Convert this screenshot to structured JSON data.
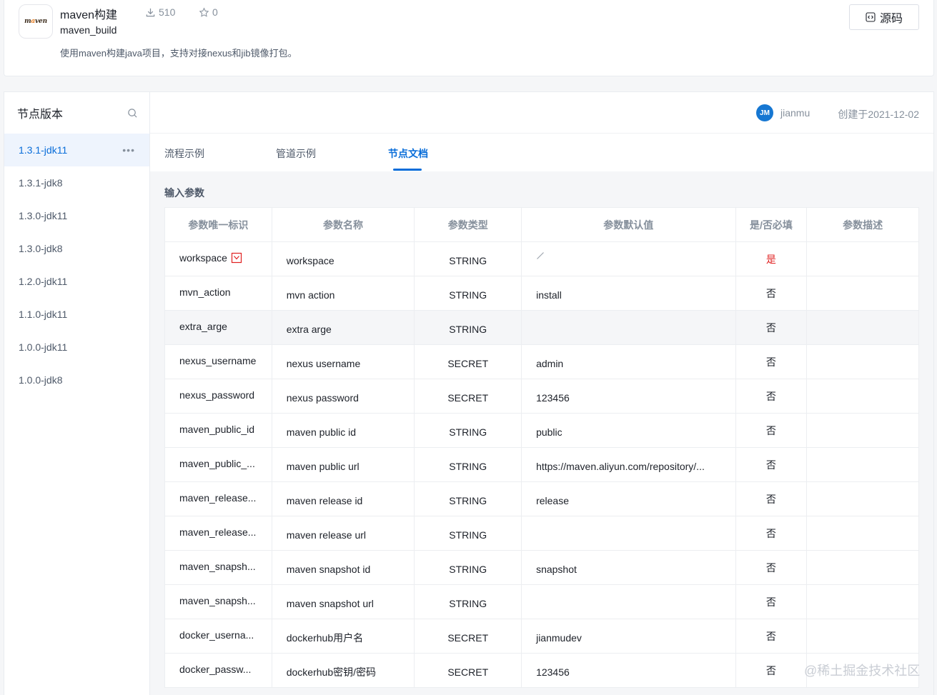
{
  "header": {
    "title": "maven构建",
    "name": "maven_build",
    "description": "使用maven构建java项目，支持对接nexus和jib镜像打包。",
    "downloads": "510",
    "stars": "0",
    "source_button": "源码",
    "logo_text_1": "m",
    "logo_text_a": "a",
    "logo_text_2": "ven"
  },
  "sidebar": {
    "title": "节点版本",
    "versions": [
      "1.3.1-jdk11",
      "1.3.1-jdk8",
      "1.3.0-jdk11",
      "1.3.0-jdk8",
      "1.2.0-jdk11",
      "1.1.0-jdk11",
      "1.0.0-jdk11",
      "1.0.0-jdk8"
    ],
    "active_index": 0,
    "more_glyph": "•••"
  },
  "meta": {
    "avatar_text": "JM",
    "author": "jianmu",
    "created": "创建于2021-12-02"
  },
  "tabs": [
    "流程示例",
    "管道示例",
    "节点文档"
  ],
  "section_title": "输入参数",
  "table": {
    "headers": [
      "参数唯一标识",
      "参数名称",
      "参数类型",
      "参数默认值",
      "是/否必填",
      "参数描述"
    ],
    "rows": [
      {
        "key": "workspace",
        "name": "workspace",
        "type": "STRING",
        "default": "",
        "required": "是"
      },
      {
        "key": "mvn_action",
        "name": "mvn action",
        "type": "STRING",
        "default": "install",
        "required": "否"
      },
      {
        "key": "extra_arge",
        "name": "extra arge",
        "type": "STRING",
        "default": "",
        "required": "否"
      },
      {
        "key": "nexus_username",
        "name": "nexus username",
        "type": "SECRET",
        "default": "admin",
        "required": "否"
      },
      {
        "key": "nexus_password",
        "name": "nexus password",
        "type": "SECRET",
        "default": "123456",
        "required": "否"
      },
      {
        "key": "maven_public_id",
        "name": "maven public id",
        "type": "STRING",
        "default": "public",
        "required": "否"
      },
      {
        "key": "maven_public_...",
        "name": "maven public url",
        "type": "STRING",
        "default": "https://maven.aliyun.com/repository/...",
        "required": "否"
      },
      {
        "key": "maven_release...",
        "name": "maven release id",
        "type": "STRING",
        "default": "release",
        "required": "否"
      },
      {
        "key": "maven_release...",
        "name": "maven release url",
        "type": "STRING",
        "default": "",
        "required": "否"
      },
      {
        "key": "maven_snapsh...",
        "name": "maven snapshot id",
        "type": "STRING",
        "default": "snapshot",
        "required": "否"
      },
      {
        "key": "maven_snapsh...",
        "name": "maven snapshot url",
        "type": "STRING",
        "default": "",
        "required": "否"
      },
      {
        "key": "docker_userna...",
        "name": "dockerhub用户名",
        "type": "SECRET",
        "default": "jianmudev",
        "required": "否"
      },
      {
        "key": "docker_passw...",
        "name": "dockerhub密钥/密码",
        "type": "SECRET",
        "default": "123456",
        "required": "否"
      }
    ]
  },
  "watermark": "@稀土掘金技术社区",
  "colors": {
    "accent": "#096dd9",
    "required": "#e02020"
  }
}
